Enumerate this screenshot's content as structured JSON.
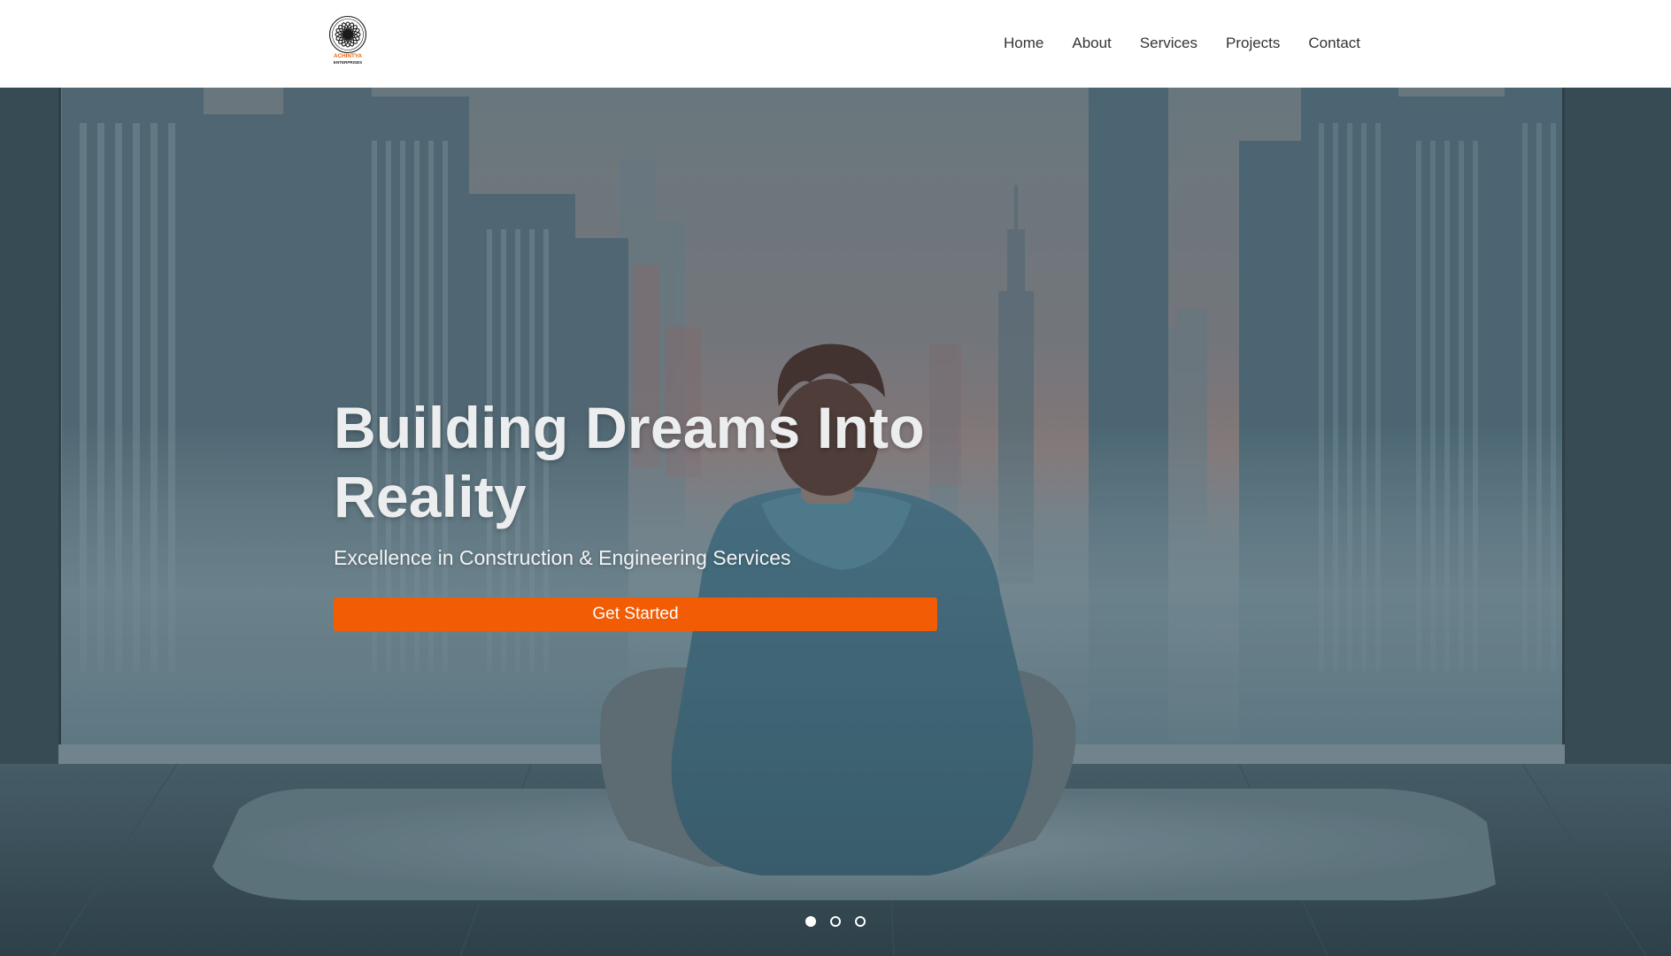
{
  "brand": {
    "logo_icon": "mandala-logo-icon",
    "name": "ACHINTYA",
    "tagline": "ENTERPRISES"
  },
  "nav": {
    "items": [
      {
        "label": "Home"
      },
      {
        "label": "About"
      },
      {
        "label": "Services"
      },
      {
        "label": "Projects"
      },
      {
        "label": "Contact"
      }
    ]
  },
  "hero": {
    "title": "Building Dreams Into Reality",
    "subtitle": "Excellence in Construction & Engineering Services",
    "cta_label": "Get Started",
    "background_description_icon": "city-window-meditation-photo",
    "slides": {
      "count": 3,
      "active_index": 0
    }
  },
  "colors": {
    "accent": "#f25c05",
    "header_bg": "#ffffff",
    "nav_text": "#333333",
    "hero_text": "#ecedee"
  }
}
